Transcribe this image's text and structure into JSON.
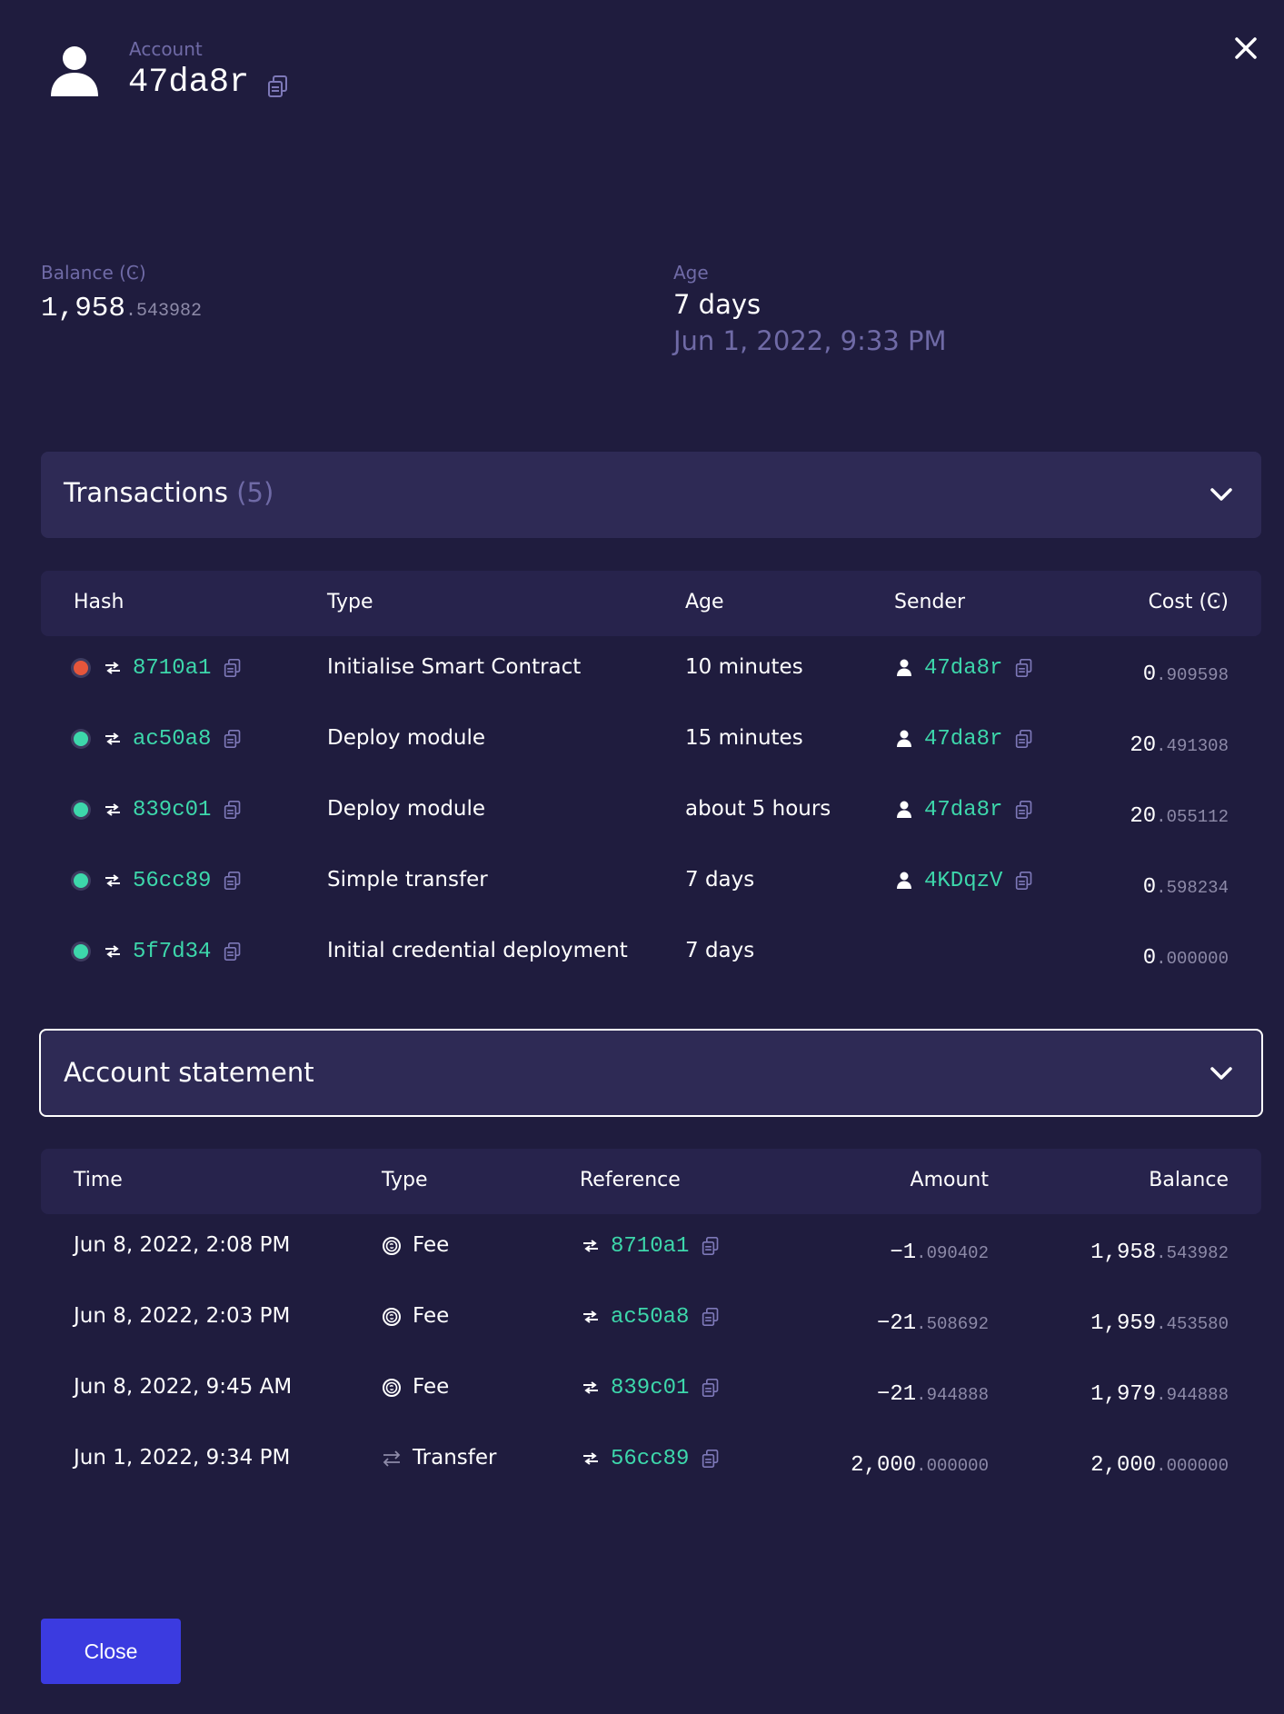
{
  "account": {
    "label": "Account",
    "id": "47da8r"
  },
  "balance": {
    "label": "Balance (Ͼ)",
    "int": "1,958",
    "dec": ".543982"
  },
  "age": {
    "label": "Age",
    "value": "7 days",
    "date": "Jun 1, 2022, 9:33 PM"
  },
  "transactions": {
    "title": "Transactions",
    "count": "(5)",
    "columns": {
      "hash": "Hash",
      "type": "Type",
      "age": "Age",
      "sender": "Sender",
      "cost": "Cost (Ͼ)"
    },
    "rows": [
      {
        "status": "failed",
        "hash": "8710a1",
        "type": "Initialise Smart Contract",
        "age": "10 minutes",
        "sender": "47da8r",
        "cost_int": "0",
        "cost_dec": ".909598"
      },
      {
        "status": "success",
        "hash": "ac50a8",
        "type": "Deploy module",
        "age": "15 minutes",
        "sender": "47da8r",
        "cost_int": "20",
        "cost_dec": ".491308"
      },
      {
        "status": "success",
        "hash": "839c01",
        "type": "Deploy module",
        "age": "about 5 hours",
        "sender": "47da8r",
        "cost_int": "20",
        "cost_dec": ".055112"
      },
      {
        "status": "success",
        "hash": "56cc89",
        "type": "Simple transfer",
        "age": "7 days",
        "sender": "4KDqzV",
        "cost_int": "0",
        "cost_dec": ".598234"
      },
      {
        "status": "success",
        "hash": "5f7d34",
        "type": "Initial credential deployment",
        "age": "7 days",
        "sender": "",
        "cost_int": "0",
        "cost_dec": ".000000"
      }
    ]
  },
  "statement": {
    "title": "Account statement",
    "columns": {
      "time": "Time",
      "type": "Type",
      "reference": "Reference",
      "amount": "Amount",
      "balance": "Balance"
    },
    "rows": [
      {
        "time": "Jun 8, 2022, 2:08 PM",
        "type": "Fee",
        "icon": "fee-icon",
        "reference": "8710a1",
        "amount_int": "−1",
        "amount_dec": ".090402",
        "balance_int": "1,958",
        "balance_dec": ".543982"
      },
      {
        "time": "Jun 8, 2022, 2:03 PM",
        "type": "Fee",
        "icon": "fee-icon",
        "reference": "ac50a8",
        "amount_int": "−21",
        "amount_dec": ".508692",
        "balance_int": "1,959",
        "balance_dec": ".453580"
      },
      {
        "time": "Jun 8, 2022, 9:45 AM",
        "type": "Fee",
        "icon": "fee-icon",
        "reference": "839c01",
        "amount_int": "−21",
        "amount_dec": ".944888",
        "balance_int": "1,979",
        "balance_dec": ".944888"
      },
      {
        "time": "Jun 1, 2022, 9:34 PM",
        "type": "Transfer",
        "icon": "transfer-icon",
        "reference": "56cc89",
        "amount_int": "2,000",
        "amount_dec": ".000000",
        "balance_int": "2,000",
        "balance_dec": ".000000"
      }
    ]
  },
  "close_button": {
    "label": "Close"
  },
  "colors": {
    "background": "#1f1c3e",
    "accent": "#3dd7ab",
    "muted": "#6f6aa6",
    "failed": "#e5563b",
    "success": "#3dd7ab",
    "button": "#3b3be0"
  }
}
